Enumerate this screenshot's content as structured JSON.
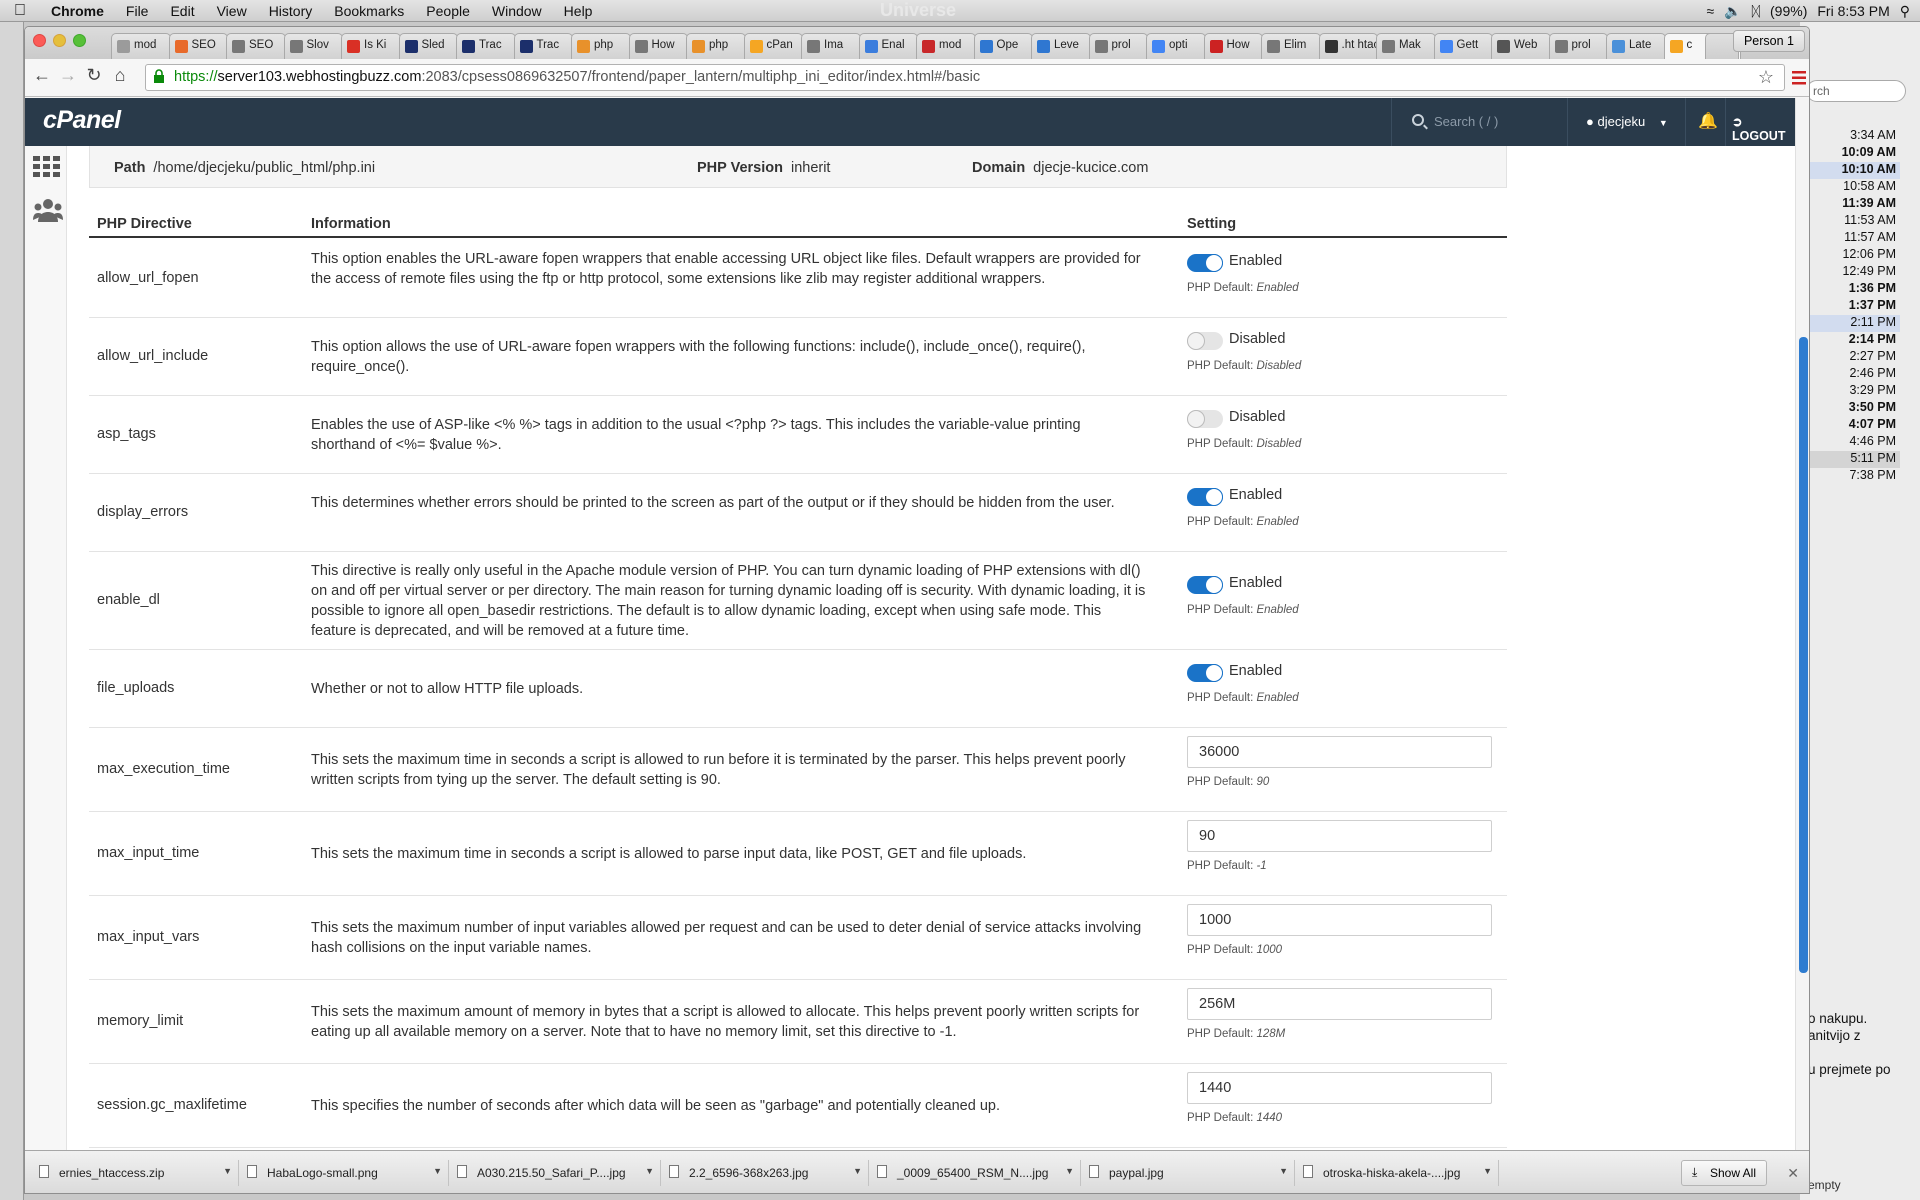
{
  "menubar": {
    "app": "Chrome",
    "items": [
      "File",
      "Edit",
      "View",
      "History",
      "Bookmarks",
      "People",
      "Window",
      "Help"
    ],
    "ghost_title": "Universe",
    "battery": "(99%)",
    "clock": "Fri 8:53 PM"
  },
  "browser": {
    "tabs": [
      "mod",
      "SEO",
      "SEO",
      "Slov",
      "Is Ki",
      "Sled",
      "Trac",
      "Trac",
      "php",
      "How",
      "php",
      "cPan",
      "Ima",
      "Enal",
      "mod",
      "Ope",
      "Leve",
      "prol",
      "opti",
      "How",
      "Elim",
      ".ht htac",
      "Mak",
      "Gett",
      "Web",
      "prol",
      "Late",
      "c"
    ],
    "active_tab_index": 27,
    "person": "Person 1",
    "url_scheme": "https://",
    "url_host": "server103.webhostingbuzz.com",
    "url_rest": ":2083/cpsess0869632507/frontend/paper_lantern/multiphp_ini_editor/index.html#/basic"
  },
  "cpanel": {
    "logo": "cPanel",
    "search_placeholder": "Search ( / )",
    "user": "djecjeku",
    "logout": "LOGOUT"
  },
  "info": {
    "path_label": "Path",
    "path": "/home/djecjeku/public_html/php.ini",
    "version_label": "PHP Version",
    "version": "inherit",
    "domain_label": "Domain",
    "domain": "djecje-kucice.com"
  },
  "table": {
    "headers": [
      "PHP Directive",
      "Information",
      "Setting"
    ],
    "default_prefix": "PHP Default:",
    "rows": [
      {
        "name": "allow_url_fopen",
        "info": "This option enables the URL-aware fopen wrappers that enable accessing URL object like files. Default wrappers are provided for the access of remote files using the ftp or http protocol, some extensions like zlib may register additional wrappers.",
        "type": "toggle",
        "on": true,
        "value": "Enabled",
        "default": "Enabled"
      },
      {
        "name": "allow_url_include",
        "info": "This option allows the use of URL-aware fopen wrappers with the following functions: include(), include_once(), require(), require_once().",
        "type": "toggle",
        "on": false,
        "value": "Disabled",
        "default": "Disabled"
      },
      {
        "name": "asp_tags",
        "info": "Enables the use of ASP-like <% %> tags in addition to the usual <?php ?> tags. This includes the variable-value printing shorthand of <%= $value %>.",
        "type": "toggle",
        "on": false,
        "value": "Disabled",
        "default": "Disabled"
      },
      {
        "name": "display_errors",
        "info": "This determines whether errors should be printed to the screen as part of the output or if they should be hidden from the user.",
        "type": "toggle",
        "on": true,
        "value": "Enabled",
        "default": "Enabled"
      },
      {
        "name": "enable_dl",
        "info": "This directive is really only useful in the Apache module version of PHP. You can turn dynamic loading of PHP extensions with dl() on and off per virtual server or per directory. The main reason for turning dynamic loading off is security. With dynamic loading, it is possible to ignore all open_basedir restrictions. The default is to allow dynamic loading, except when using safe mode. This feature is deprecated, and will be removed at a future time.",
        "type": "toggle",
        "on": true,
        "value": "Enabled",
        "default": "Enabled"
      },
      {
        "name": "file_uploads",
        "info": "Whether or not to allow HTTP file uploads.",
        "type": "toggle",
        "on": true,
        "value": "Enabled",
        "default": "Enabled"
      },
      {
        "name": "max_execution_time",
        "info": "This sets the maximum time in seconds a script is allowed to run before it is terminated by the parser. This helps prevent poorly written scripts from tying up the server. The default setting is 90.",
        "type": "input",
        "value": "36000",
        "default": "90"
      },
      {
        "name": "max_input_time",
        "info": "This sets the maximum time in seconds a script is allowed to parse input data, like POST, GET and file uploads.",
        "type": "input",
        "value": "90",
        "default": "-1"
      },
      {
        "name": "max_input_vars",
        "info": "This sets the maximum number of input variables allowed per request and can be used to deter denial of service attacks involving hash collisions on the input variable names.",
        "type": "input",
        "value": "1000",
        "default": "1000"
      },
      {
        "name": "memory_limit",
        "info": "This sets the maximum amount of memory in bytes that a script is allowed to allocate. This helps prevent poorly written scripts for eating up all available memory on a server. Note that to have no memory limit, set this directive to -1.",
        "type": "input",
        "value": "256M",
        "default": "128M"
      },
      {
        "name": "session.gc_maxlifetime",
        "info": "This specifies the number of seconds after which data will be seen as \"garbage\" and potentially cleaned up.",
        "type": "input",
        "value": "1440",
        "default": "1440"
      }
    ]
  },
  "downloads": {
    "items": [
      "ernies_htaccess.zip",
      "HabaLogo-small.png",
      "A030.215.50_Safari_P....jpg",
      "2.2_6596-368x263.jpg",
      "_0009_65400_RSM_N....jpg",
      "paypal.jpg",
      "otroska-hiska-akela-....jpg"
    ],
    "show_all": "Show All"
  },
  "background_app": {
    "search": "rch",
    "times": [
      "3:34 AM",
      "10:09 AM",
      "10:10 AM",
      "10:58 AM",
      "11:39 AM",
      "11:53 AM",
      "11:57 AM",
      "12:06 PM",
      "12:49 PM",
      "1:36 PM",
      "1:37 PM",
      "2:11 PM",
      "2:14 PM",
      "2:27 PM",
      "2:46 PM",
      "3:29 PM",
      "3:50 PM",
      "4:07 PM",
      "4:46 PM",
      "5:11 PM",
      "7:38 PM"
    ],
    "snippet": [
      "o nakupu.",
      "anitvijo z",
      "",
      "u prejmete po"
    ],
    "footer": "empty"
  }
}
